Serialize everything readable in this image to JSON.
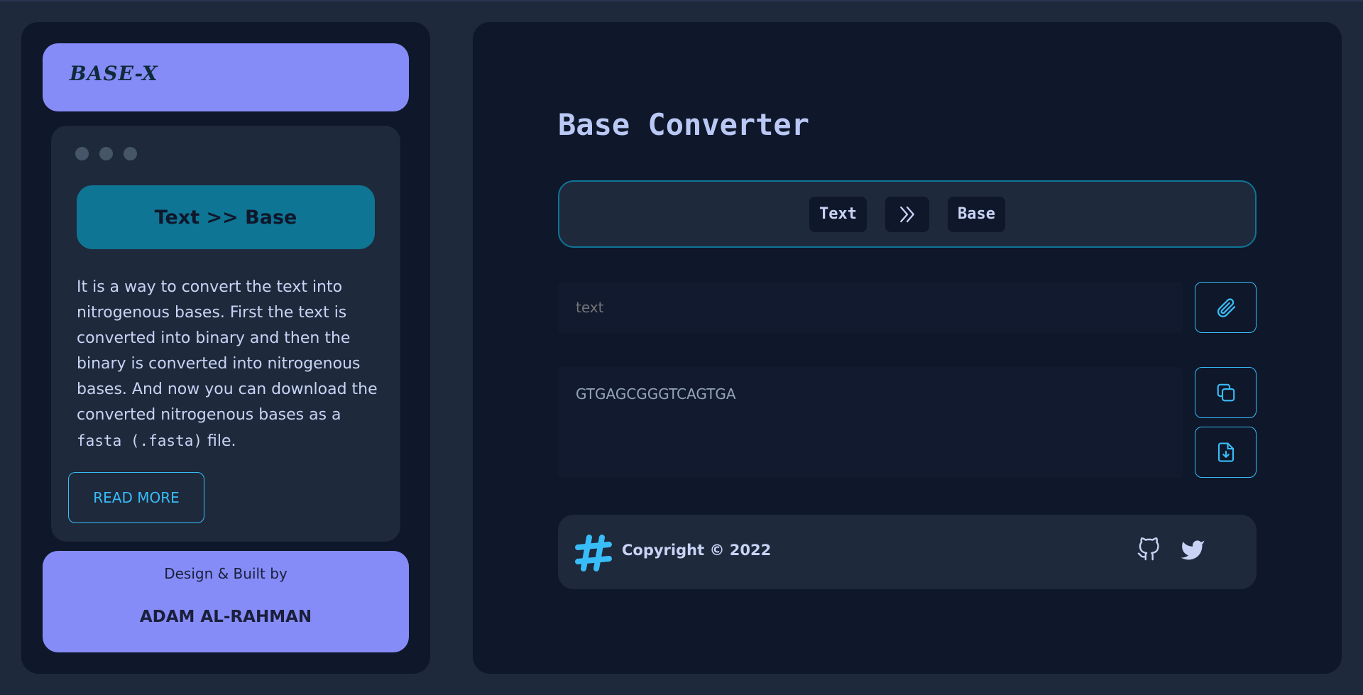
{
  "sidebar": {
    "logo": "BASE-X",
    "card": {
      "mode_title": "Text >> Base",
      "description_main": "It is a way to convert the text into nitrogenous bases. First the text is converted into binary and then the binary is converted into nitrogenous bases. And now you can download the converted nitrogenous bases as a ",
      "description_code": "fasta (.fasta)",
      "description_end": " file.",
      "read_more": "READ MORE"
    },
    "credit": {
      "label": "Design & Built by",
      "name": "ADAM AL-RAHMAN"
    }
  },
  "main": {
    "title": "Base Converter",
    "mode": {
      "from": "Text",
      "to": "Base",
      "arrow_icon": "double-chevron-right-icon"
    },
    "input": {
      "placeholder": "text"
    },
    "output": {
      "value": "GTGAGCGGGTCAGTGA"
    },
    "buttons": {
      "attach_icon": "paperclip-icon",
      "copy_icon": "copy-icon",
      "download_icon": "file-download-icon"
    },
    "footer": {
      "copyright": "Copyright © 2022",
      "logo_icon": "slack-hash-icon",
      "social": [
        "github-icon",
        "twitter-icon"
      ]
    }
  },
  "colors": {
    "background": "#1e293b",
    "panel": "#0f172a",
    "accent": "#868cf7",
    "teal": "#0f7595",
    "sky": "#38bdf8"
  }
}
